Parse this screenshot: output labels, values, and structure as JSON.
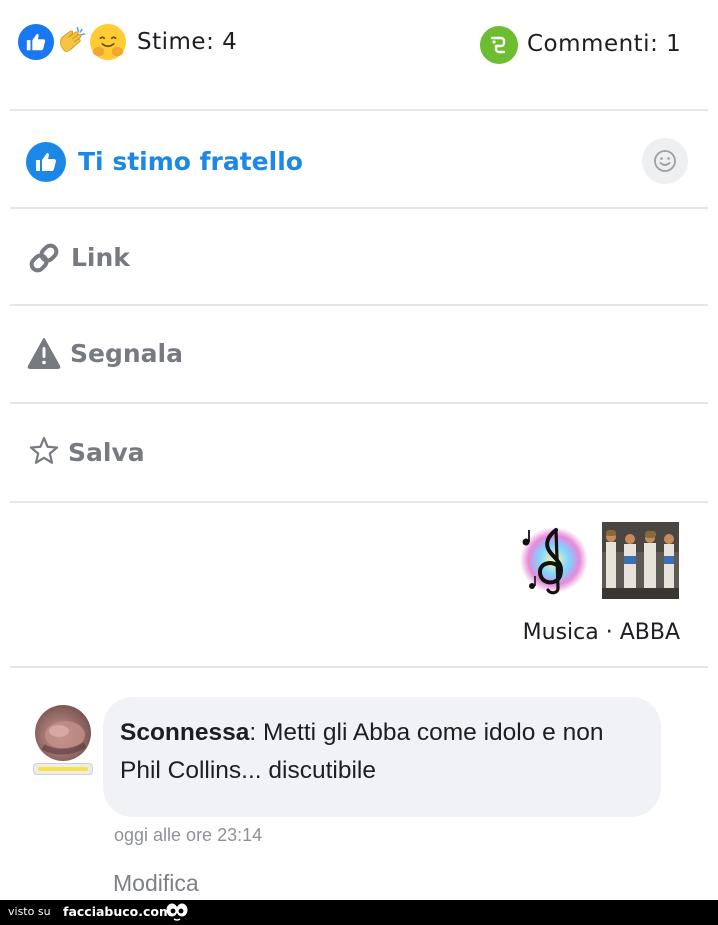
{
  "stats": {
    "stime_label": "Stime: 4",
    "commenti_label": "Commenti: 1",
    "reaction_icons": [
      "like-icon",
      "clap-icon",
      "hug-icon"
    ]
  },
  "actions": {
    "stimo_label": "Ti stimo fratello",
    "link_label": "Link",
    "segnala_label": "Segnala",
    "salva_label": "Salva"
  },
  "tags": {
    "line": "Musica · ABBA",
    "items": [
      "Musica",
      "ABBA"
    ]
  },
  "comment": {
    "author": "Sconnessa",
    "text": ": Metti gli Abba come idolo e non Phil Collins... discutibile",
    "time": "oggi alle ore 23:14",
    "edit_label": "Modifica"
  },
  "footer": {
    "visto_su": "visto su",
    "site": "facciabuco.com"
  },
  "colors": {
    "accent_blue": "#1b87e6",
    "comment_green": "#6cbd2f",
    "action_gray": "#777a80",
    "bubble_bg": "#f0f2f5"
  }
}
